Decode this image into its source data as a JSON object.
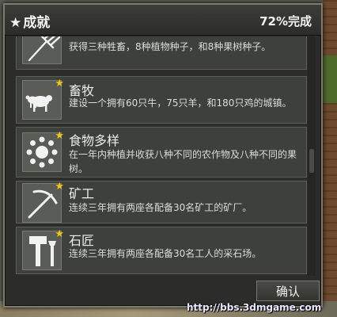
{
  "window": {
    "title": "成就",
    "title_star": "★",
    "progress": "72%完成"
  },
  "achievements": [
    {
      "icon": "pitchfork-icon",
      "title": "",
      "desc": "获得三种牲畜，8种植物种子，和8种果树种子。",
      "starred": false
    },
    {
      "icon": "livestock-icon",
      "title": "畜牧",
      "desc": "建设一个拥有60只牛，75只羊，和180只鸡的城镇。",
      "starred": true
    },
    {
      "icon": "food-variety-icon",
      "title": "食物多样",
      "desc": "在一年内种植并收获八种不同的农作物及八种不同的果树。",
      "starred": true
    },
    {
      "icon": "pickaxe-icon",
      "title": "矿工",
      "desc": "连续三年拥有两座各配备30名矿工的矿厂。",
      "starred": true
    },
    {
      "icon": "stonecutter-icon",
      "title": "石匠",
      "desc": "连续三年拥有两座各配备30名工人的采石场。",
      "starred": true
    }
  ],
  "star_glyph": "★",
  "confirm_label": "确认",
  "watermark": "http://bbs.3dmgame.com",
  "colors": {
    "star": "#f0c419",
    "panel": "#2c2d2a",
    "item": "#3e403c"
  }
}
